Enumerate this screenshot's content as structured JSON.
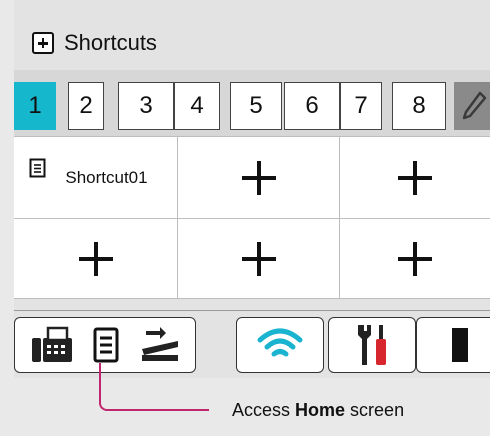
{
  "header": {
    "title": "Shortcuts",
    "add_icon": "plus-box-icon"
  },
  "tabs": [
    "1",
    "2",
    "3",
    "4",
    "5",
    "6",
    "7",
    "8"
  ],
  "active_tab": "1",
  "edit_icon": "pencil-icon",
  "grid": {
    "shortcut": {
      "name": "Shortcut01",
      "icon": "document-icon"
    },
    "add_icon": "plus-icon"
  },
  "bottom_bar": {
    "icons": [
      "fax-icon",
      "document-icon",
      "scanner-icon",
      "wifi-icon",
      "tools-icon",
      "toner-icon"
    ],
    "colors": {
      "wifi": "#1ab3d0",
      "tools_red": "#d8262f"
    }
  },
  "callout": {
    "prefix": "Access ",
    "bold": "Home",
    "suffix": " screen",
    "line_color": "#c0266e"
  },
  "colors": {
    "active_tab": "#14b7cc"
  }
}
